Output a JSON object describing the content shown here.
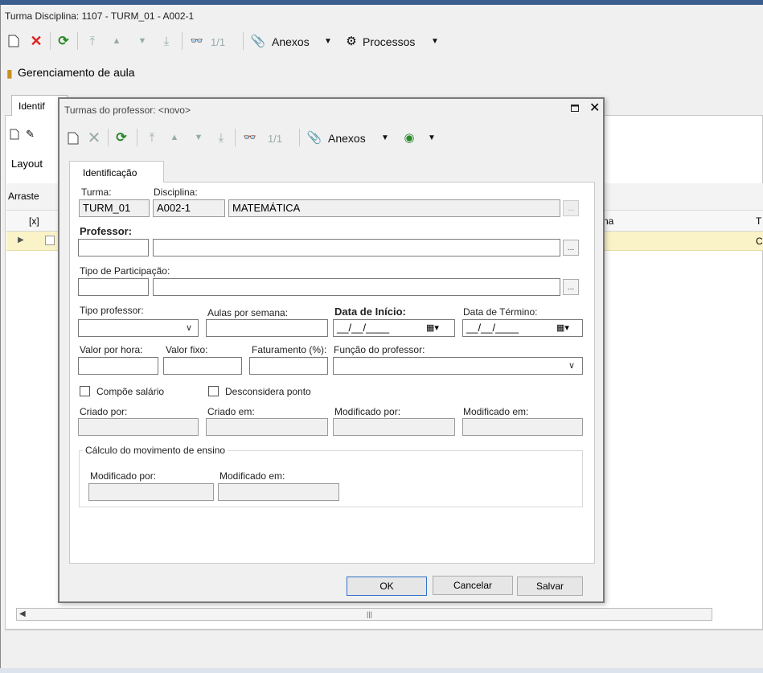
{
  "main_window": {
    "title": "Turma Disciplina: 1107 - TURM_01 - A002-1",
    "toolbar": {
      "record_count": "1/1",
      "attachments_label": "Anexos",
      "processes_label": "Processos"
    },
    "section_title": "Gerenciamento de aula",
    "background": {
      "tab_label": "Identif",
      "layout_label": "Layout",
      "group_hint": "Arraste",
      "col_select": "[x]",
      "col_partial_a": "na",
      "col_partial_b": "T",
      "row_partial": "C"
    }
  },
  "dialog": {
    "title": "Turmas do professor: <novo>",
    "toolbar": {
      "record_count": "1/1",
      "attachments_label": "Anexos"
    },
    "tab": "Identificação",
    "labels": {
      "turma": "Turma:",
      "disciplina": "Disciplina:",
      "professor": "Professor:",
      "tipo_participacao": "Tipo de Participação:",
      "tipo_professor": "Tipo professor:",
      "aulas_semana": "Aulas por semana:",
      "data_inicio": "Data de Início:",
      "data_termino": "Data de Término:",
      "valor_hora": "Valor por hora:",
      "valor_fixo": "Valor fixo:",
      "faturamento": "Faturamento (%):",
      "funcao_professor": "Função do professor:",
      "compoe_salario": "Compõe salário",
      "desconsidera_ponto": "Desconsidera ponto",
      "criado_por": "Criado por:",
      "criado_em": "Criado em:",
      "modificado_por": "Modificado por:",
      "modificado_em": "Modificado em:",
      "calculo_group": "Cálculo do movimento de ensino",
      "calc_modificado_por": "Modificado por:",
      "calc_modificado_em": "Modificado em:"
    },
    "values": {
      "turma": "TURM_01",
      "disciplina_code": "A002-1",
      "disciplina_name": "MATEMÁTICA",
      "data_inicio": "__/__/____",
      "data_termino": "__/__/____",
      "compoe_salario_checked": false,
      "desconsidera_ponto_checked": false
    },
    "buttons": {
      "ok": "OK",
      "cancel": "Cancelar",
      "save": "Salvar"
    }
  },
  "colors": {
    "delete_red": "#e02020",
    "refresh_green": "#2a8a2a",
    "default_button_border": "#2f73c9",
    "row_highlight": "#fbf3c8"
  }
}
